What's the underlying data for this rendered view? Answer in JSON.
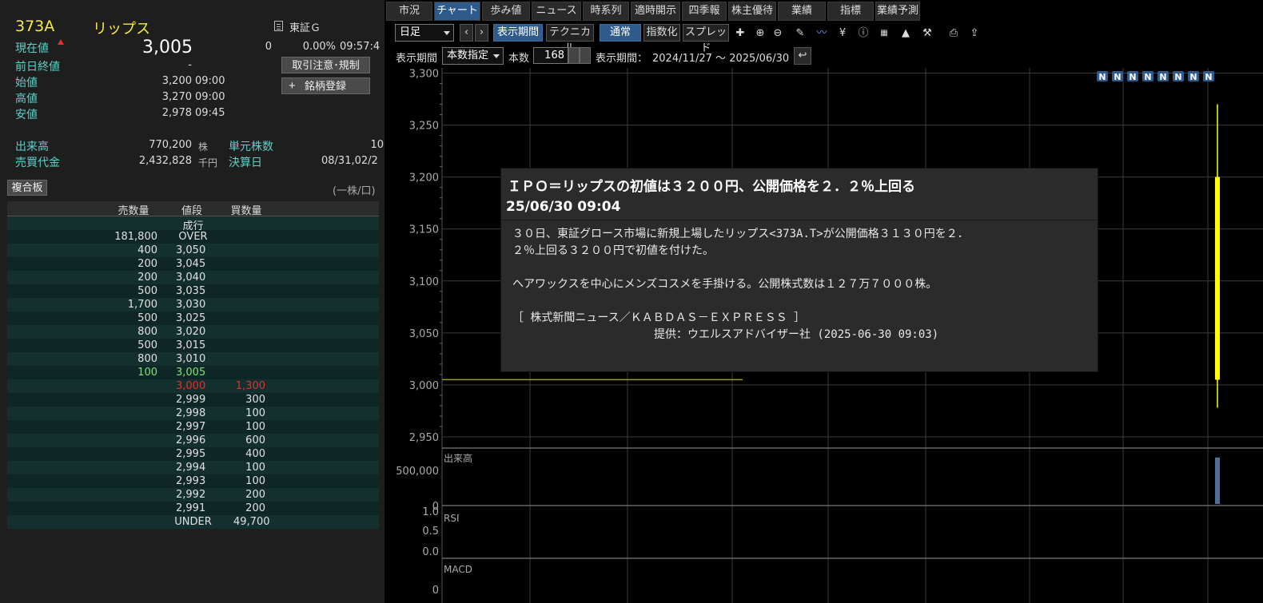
{
  "quote": {
    "code": "373A",
    "name": "リップス",
    "exchange": "東証Ｇ",
    "current_label": "現在値",
    "current_price": "3,005",
    "change": "0",
    "change_pct": "0.00%",
    "time": "09:57:4",
    "prev_close_label": "前日終値",
    "prev_close": "-",
    "open_label": "始値",
    "open": "3,200",
    "open_time": "09:00",
    "high_label": "高値",
    "high": "3,270",
    "high_time": "09:00",
    "low_label": "安値",
    "low": "2,978",
    "low_time": "09:45",
    "volume_label": "出来高",
    "volume": "770,200",
    "volume_unit": "株",
    "turnover_label": "売買代金",
    "turnover": "2,432,828",
    "turnover_unit": "千円",
    "lot_label": "単元株数",
    "lot": "10",
    "settle_label": "決算日",
    "settle": "08/31,02/2",
    "btn_notice": "取引注意･規制",
    "btn_register": "銘柄登録",
    "btn_register_icon": "plus-icon",
    "fukugo": "複合板",
    "unit_note": "(一株/口)"
  },
  "book": {
    "headers": [
      "売数量",
      "値段",
      "買数量"
    ],
    "market_label": "成行",
    "rows": [
      {
        "sell": "181,800",
        "price": "OVER",
        "buy": ""
      },
      {
        "sell": "400",
        "price": "3,050",
        "buy": ""
      },
      {
        "sell": "200",
        "price": "3,045",
        "buy": ""
      },
      {
        "sell": "200",
        "price": "3,040",
        "buy": ""
      },
      {
        "sell": "500",
        "price": "3,035",
        "buy": ""
      },
      {
        "sell": "1,700",
        "price": "3,030",
        "buy": ""
      },
      {
        "sell": "500",
        "price": "3,025",
        "buy": ""
      },
      {
        "sell": "800",
        "price": "3,020",
        "buy": ""
      },
      {
        "sell": "500",
        "price": "3,015",
        "buy": ""
      },
      {
        "sell": "800",
        "price": "3,010",
        "buy": ""
      },
      {
        "sell": "100",
        "price": "3,005",
        "buy": "",
        "hl": "green"
      },
      {
        "sell": "",
        "price": "3,000",
        "buy": "1,300",
        "hl": "red"
      },
      {
        "sell": "",
        "price": "2,999",
        "buy": "300"
      },
      {
        "sell": "",
        "price": "2,998",
        "buy": "100"
      },
      {
        "sell": "",
        "price": "2,997",
        "buy": "100"
      },
      {
        "sell": "",
        "price": "2,996",
        "buy": "600"
      },
      {
        "sell": "",
        "price": "2,995",
        "buy": "400"
      },
      {
        "sell": "",
        "price": "2,994",
        "buy": "100"
      },
      {
        "sell": "",
        "price": "2,993",
        "buy": "100"
      },
      {
        "sell": "",
        "price": "2,992",
        "buy": "200"
      },
      {
        "sell": "",
        "price": "2,991",
        "buy": "200"
      },
      {
        "sell": "",
        "price": "UNDER",
        "buy": "49,700"
      }
    ]
  },
  "tabs": [
    "市況",
    "チャート",
    "歩み値",
    "ニュース",
    "時系列",
    "適時開示",
    "四季報",
    "株主優待",
    "業績",
    "指標",
    "業績予測"
  ],
  "active_tab": 1,
  "toolbar": {
    "period_select": "日足",
    "btn_period": "表示期間",
    "btn_technical": "テクニカル",
    "btn_normal": "通常",
    "btn_index": "指数化",
    "btn_spread": "スプレッド",
    "icons": [
      "crosshair-icon",
      "zoom-in-icon",
      "zoom-out-icon",
      "pencil-icon",
      "pattern-icon",
      "yen-icon",
      "info-icon",
      "news-marker-icon",
      "area-chart-icon",
      "wrench-icon",
      "print-icon",
      "export-icon"
    ]
  },
  "period": {
    "label": "表示期間",
    "mode": "本数指定",
    "count_label": "本数",
    "count": "168",
    "range_label": "表示期間：",
    "range": "2024/11/27 ～ 2025/06/30"
  },
  "news": {
    "title": "ＩＰＯ＝リップスの初値は３２００円、公開価格を２．２％上回る",
    "time": "25/06/30 09:04",
    "body": "３０日、東証グロース市場に新規上場したリップス<373A.T>が公開価格３１３０円を２．\n２％上回る３２００円で初値を付けた。\n\nヘアワックスを中心にメンズコスメを手掛ける。公開株式数は１２７万７０００株。\n\n［ 株式新聞ニュース／ＫＡＢＤＡＳ－ＥＸＰＲＥＳＳ ］\n                     提供：ウエルスアドバイザー社 (2025-06-30 09:03)"
  },
  "chart_data": {
    "type": "candlestick",
    "price_axis": {
      "ticks": [
        "3,300",
        "3,250",
        "3,200",
        "3,150",
        "3,100",
        "3,050",
        "3,000",
        "2,950"
      ],
      "range": [
        2940,
        3305
      ]
    },
    "candles": [
      {
        "date": "2025/06/30",
        "open": 3200,
        "high": 3270,
        "low": 2978,
        "close": 3005
      }
    ],
    "reference_line": 3005,
    "news_markers": [
      "N",
      "N",
      "N",
      "N",
      "N",
      "N",
      "N",
      "N"
    ],
    "volume": {
      "label": "出来高",
      "ticks": [
        "500,000",
        "0"
      ],
      "value": 770200
    },
    "rsi": {
      "label": "RSI",
      "ticks": [
        "1.0",
        "0.5",
        "0.0"
      ]
    },
    "macd": {
      "label": "MACD",
      "ticks": [
        "0"
      ]
    },
    "colors": {
      "candle": "#ffff00",
      "volume": "#4f6f99",
      "grid": "#3a3a3a",
      "axis": "#aaaaaa",
      "marker": "#2f5b8c"
    }
  }
}
